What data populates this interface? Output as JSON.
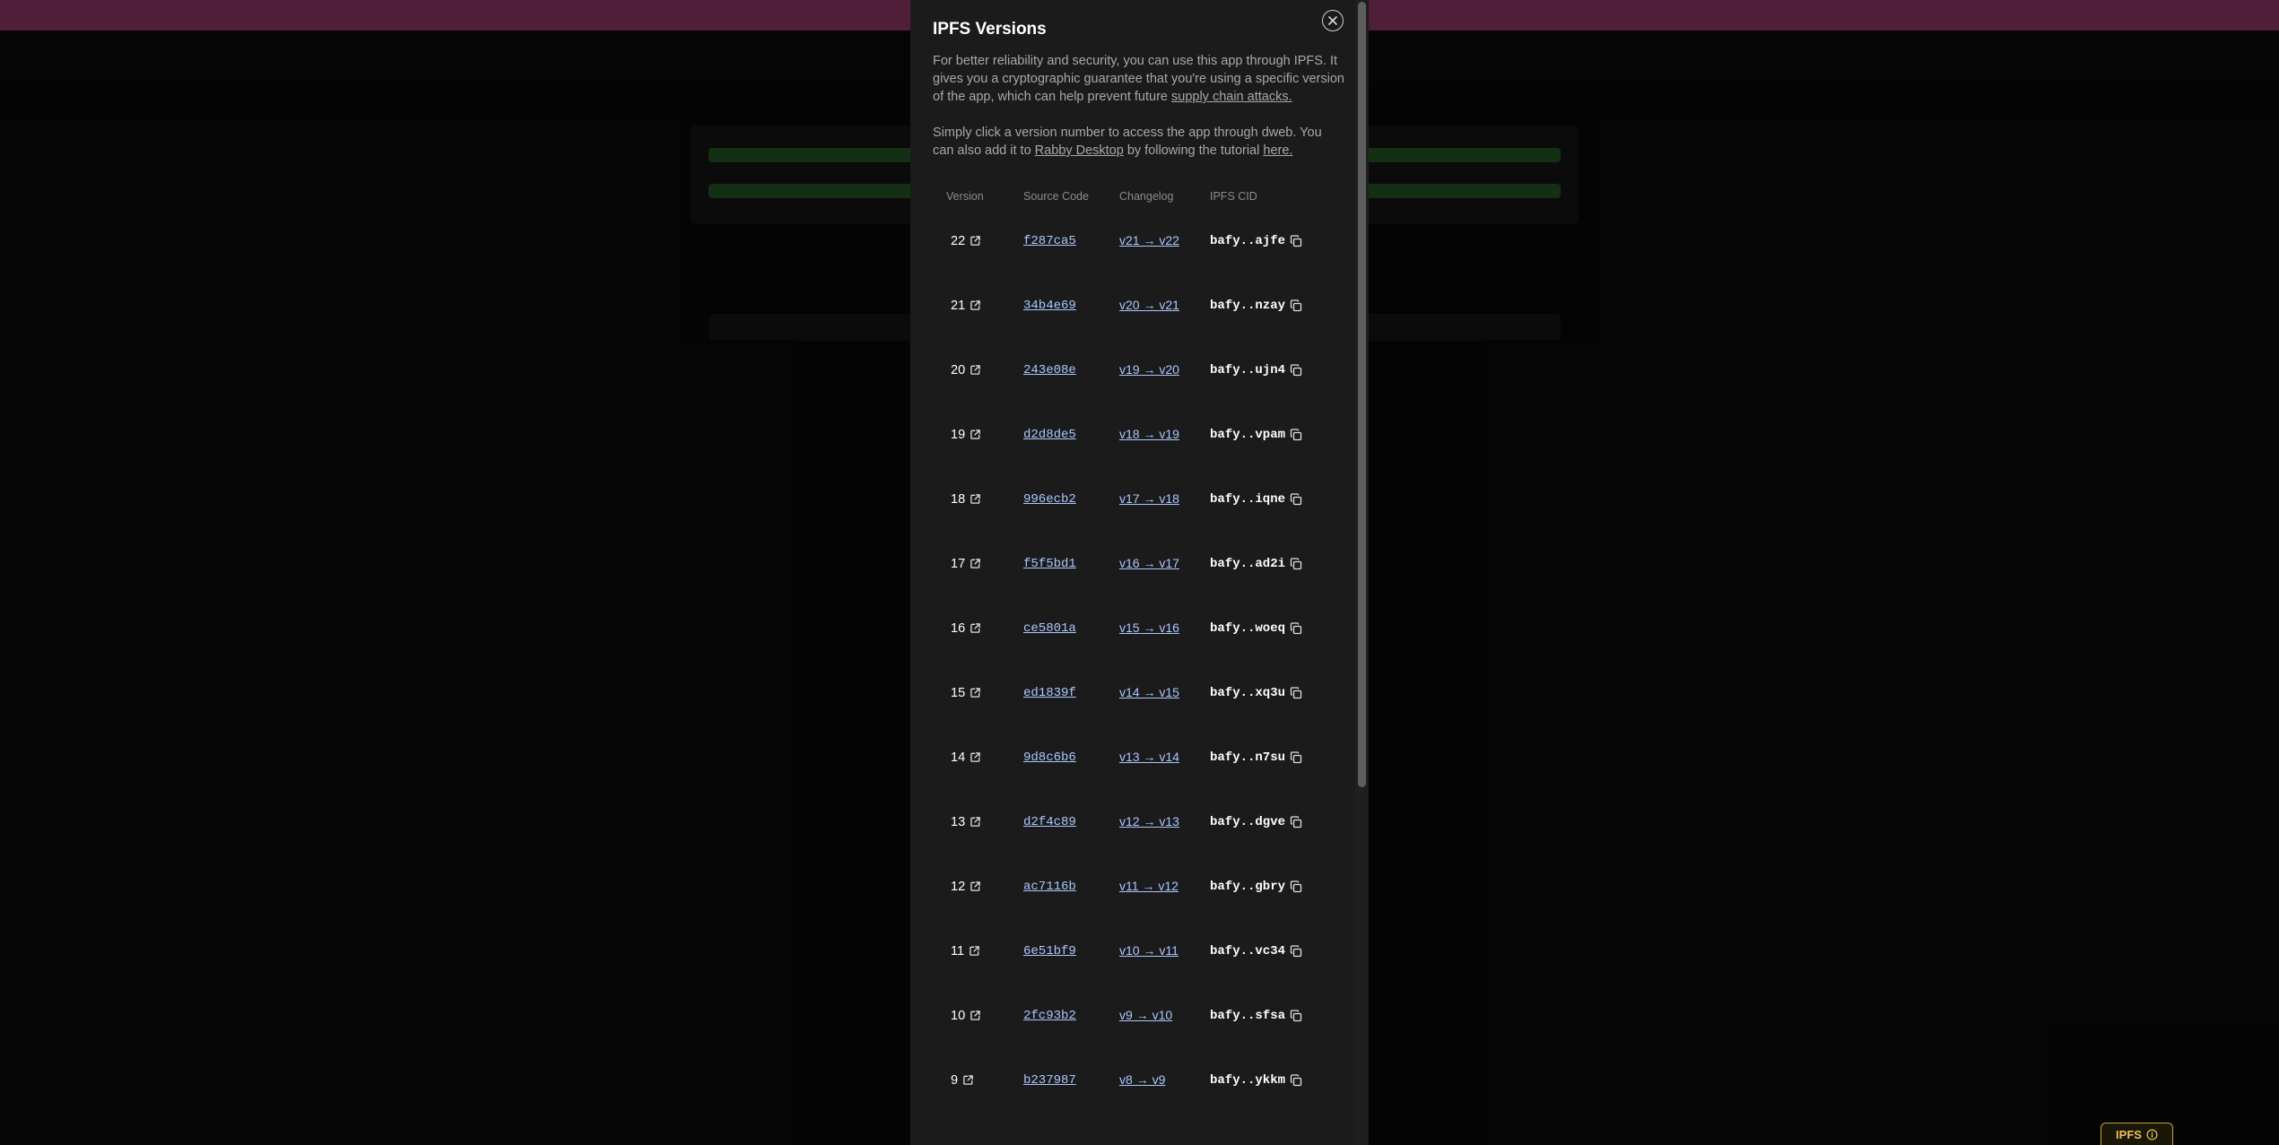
{
  "modal": {
    "title": "IPFS Versions",
    "paragraph1_text": "For better reliability and security, you can use this app through IPFS. It gives you a cryptographic guarantee that you're using a specific version of the app, which can help prevent future ",
    "paragraph1_link": "supply chain attacks.",
    "paragraph2_text_a": "Simply click a version number to access the app through dweb. You can also add it to ",
    "paragraph2_link_a": "Rabby Desktop",
    "paragraph2_text_b": " by following the tutorial ",
    "paragraph2_link_b": "here."
  },
  "table": {
    "headers": {
      "version": "Version",
      "source": "Source Code",
      "changelog": "Changelog",
      "cid": "IPFS CID"
    },
    "rows": [
      {
        "version": "22",
        "source": "f287ca5",
        "changelog": "v21 → v22",
        "cid": "bafy..ajfe"
      },
      {
        "version": "21",
        "source": "34b4e69",
        "changelog": "v20 → v21",
        "cid": "bafy..nzay"
      },
      {
        "version": "20",
        "source": "243e08e",
        "changelog": "v19 → v20",
        "cid": "bafy..ujn4"
      },
      {
        "version": "19",
        "source": "d2d8de5",
        "changelog": "v18 → v19",
        "cid": "bafy..vpam"
      },
      {
        "version": "18",
        "source": "996ecb2",
        "changelog": "v17 → v18",
        "cid": "bafy..iqne"
      },
      {
        "version": "17",
        "source": "f5f5bd1",
        "changelog": "v16 → v17",
        "cid": "bafy..ad2i"
      },
      {
        "version": "16",
        "source": "ce5801a",
        "changelog": "v15 → v16",
        "cid": "bafy..woeq"
      },
      {
        "version": "15",
        "source": "ed1839f",
        "changelog": "v14 → v15",
        "cid": "bafy..xq3u"
      },
      {
        "version": "14",
        "source": "9d8c6b6",
        "changelog": "v13 → v14",
        "cid": "bafy..n7su"
      },
      {
        "version": "13",
        "source": "d2f4c89",
        "changelog": "v12 → v13",
        "cid": "bafy..dgve"
      },
      {
        "version": "12",
        "source": "ac7116b",
        "changelog": "v11 → v12",
        "cid": "bafy..gbry"
      },
      {
        "version": "11",
        "source": "6e51bf9",
        "changelog": "v10 → v11",
        "cid": "bafy..vc34"
      },
      {
        "version": "10",
        "source": "2fc93b2",
        "changelog": "v9 → v10",
        "cid": "bafy..sfsa"
      },
      {
        "version": "9",
        "source": "b237987",
        "changelog": "v8 → v9",
        "cid": "bafy..ykkm"
      }
    ]
  },
  "badge": {
    "label": "IPFS"
  },
  "icons": {
    "close": "close-icon",
    "external": "external-link-icon",
    "copy": "copy-icon",
    "info": "info-icon"
  },
  "colors": {
    "banner": "#b0467f",
    "link": "#a9c8ff",
    "badge": "#c9a227"
  }
}
